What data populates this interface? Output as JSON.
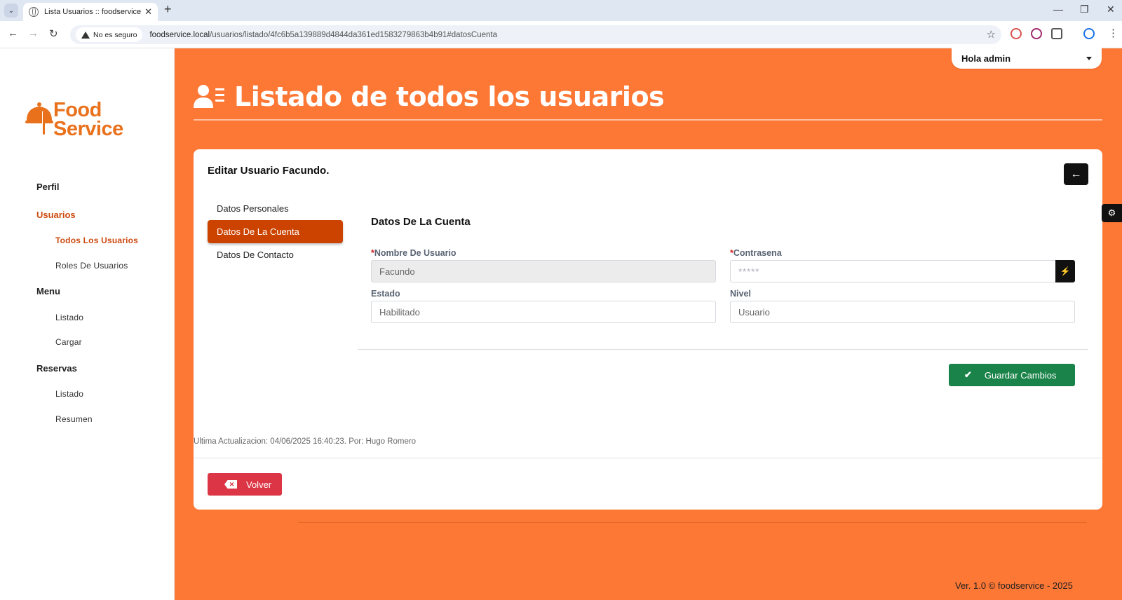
{
  "browser": {
    "tab_title": "Lista Usuarios :: foodservice",
    "security_label": "No es seguro",
    "url_host": "foodservice.local",
    "url_path": "/usuarios/listado/4fc6b5a139889d4844da361ed1583279863b4b91#datosCuenta"
  },
  "sidebar": {
    "logo_line1": "Food",
    "logo_line2": "Service",
    "items": [
      {
        "label": "Perfil"
      },
      {
        "label": "Usuarios"
      },
      {
        "label": "Todos Los Usuarios"
      },
      {
        "label": "Roles De Usuarios"
      },
      {
        "label": "Menu"
      },
      {
        "label": "Listado"
      },
      {
        "label": "Cargar"
      },
      {
        "label": "Reservas"
      },
      {
        "label": "Listado"
      },
      {
        "label": "Resumen"
      }
    ]
  },
  "header": {
    "user_greeting": "Hola admin",
    "page_title": "Listado de todos los usuarios"
  },
  "card": {
    "title": "Editar Usuario Facundo.",
    "tabs": [
      {
        "label": "Datos Personales"
      },
      {
        "label": "Datos De La Cuenta"
      },
      {
        "label": "Datos De Contacto"
      }
    ],
    "section_title": "Datos De La Cuenta",
    "fields": {
      "username_label": "Nombre De Usuario",
      "username_value": "Facundo",
      "password_label": "Contrasena",
      "password_value": "*****",
      "estado_label": "Estado",
      "estado_value": "Habilitado",
      "nivel_label": "Nivel",
      "nivel_value": "Usuario"
    },
    "required_mark": "*",
    "save_label": "Guardar Cambios",
    "last_update": "Ultima Actualizacion: 04/06/2025 16:40:23. Por: Hugo Romero",
    "back_label": "Volver"
  },
  "footer": {
    "text": "Ver. 1.0 © foodservice - 2025"
  },
  "colors": {
    "brand_orange": "#fd7735",
    "active_tab": "#cc4300",
    "save_green": "#1a8349",
    "back_red": "#dc3545"
  }
}
